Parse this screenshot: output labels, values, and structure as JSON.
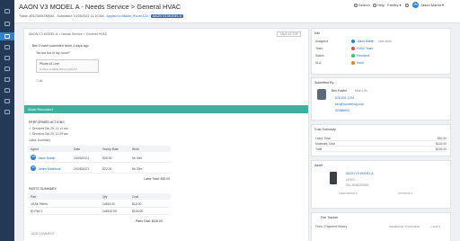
{
  "sidebar": {
    "items": [
      "dashboard",
      "tickets",
      "assets",
      "calendar",
      "reports",
      "settings",
      "people",
      "inventory",
      "integrations",
      "help"
    ]
  },
  "header": {
    "title": "AAON V3 MODEL A - Needs Service > General HVAC",
    "ticket_prefix": "Ticket: ",
    "ticket_id": "#0123456789044",
    "submitted_label": "Submitted: ",
    "submitted_value": "10/25/2021 11:10 AM",
    "location": "Applied to Middle, Room 102",
    "asset_badge": "AAON V3 MODEL A",
    "search_label": "Search",
    "help_label": "Help",
    "facility_label": "Facility ▾",
    "user_label": "Jason Martin ▾",
    "avatar_initials": "JM"
  },
  "main": {
    "breadcrumb": "AAON V3 MODEL A > Needs Service > General HVAC",
    "save_top": "SAVE AS TOP",
    "message_line": "Ben Fowler submitted ticket 4 days ago",
    "message_quote": "\"Its too hot in my room!\"",
    "phone_title": "Phone #1 Line",
    "phone_sub": "Is there a stable link anywhere?",
    "attach_line": "☐  #1",
    "work_title": "Work Recorded",
    "performed_title": "PERFORMED ACTIONS",
    "actions": [
      "✓ Serviced  Oct 25, 11:14 am",
      "✓ Serviced  Oct 25, 11:29 am"
    ],
    "labor_title": "Labor Summary",
    "labor_headers": [
      "Agent",
      "Date",
      "Hourly Rate",
      "Work"
    ],
    "labor_rows": [
      {
        "initials": "JM",
        "agent": "Jason Martin",
        "date": "10/25/2021",
        "rate": "$25.00",
        "work": "5h 30m"
      },
      {
        "initials": "JM",
        "agent": "James Matthews",
        "date": "10/25/2021",
        "rate": "$22.00",
        "work": "5h 30m"
      }
    ],
    "labor_total": "Labor Total: $30.00",
    "parts_title": "PARTS SUMMARY",
    "parts_headers": [
      "Part",
      "Qty",
      "Cost"
    ],
    "parts_rows": [
      {
        "part": "10 Air Filters",
        "qty": "1x$15.00",
        "cost": "$15.00"
      },
      {
        "part": "ID Part 1",
        "qty": "1x$100.00",
        "cost": "$100.00"
      }
    ],
    "parts_total": "Parts Total: $115.00",
    "add_comment": "ADD COMMENT"
  },
  "info": {
    "title": "Info",
    "rows": [
      {
        "key": "Assigned",
        "value": "Jason Martin",
        "extra": "view work"
      },
      {
        "key": "Team",
        "value": "HVAC Team",
        "extra": ""
      },
      {
        "key": "Status",
        "value": "Resolved",
        "extra": ""
      },
      {
        "key": "SLA",
        "value": "None",
        "extra": ""
      }
    ]
  },
  "submitted": {
    "title": "Submitted By",
    "name": "Ben Fowler",
    "role": "Main Life",
    "phone": "678-402-1234",
    "email": "ben@something.com",
    "ext": "00088ef04"
  },
  "cost": {
    "title": "Cost Summary",
    "rows": [
      {
        "label": "Labor Total",
        "value": "$30.00"
      },
      {
        "label": "Materials Total",
        "value": "$115.00"
      },
      {
        "label": "Total",
        "value": "$135.00"
      }
    ]
  },
  "asset": {
    "title": "Asset",
    "name": "AAON V3 MODEL A",
    "id_label": "LEVEL",
    "sub": "SN: 4938290492",
    "view_details": "VIEW DETAILS",
    "options": "OPTIONS ▾"
  },
  "fee": {
    "title": "Fee Tracker",
    "row_label": "Fees / Payment History",
    "generate": "GENERATE STATEMENT",
    "add": "+ ADD ▾"
  }
}
